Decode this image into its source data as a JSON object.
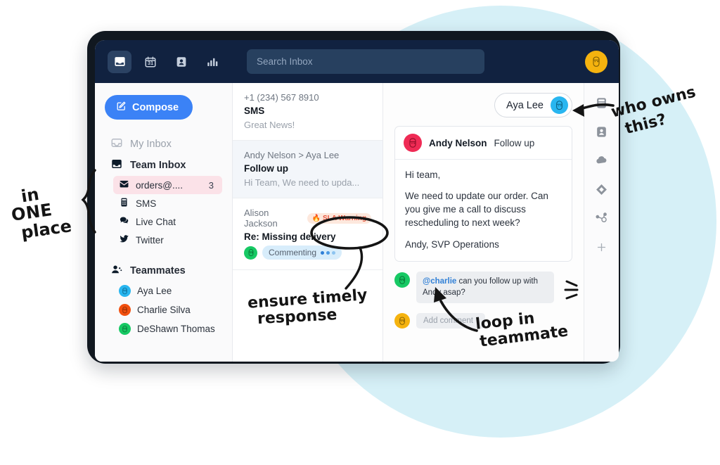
{
  "topnav": {
    "icons": [
      {
        "name": "inbox-icon",
        "label": "Inbox",
        "active": true
      },
      {
        "name": "calendar-icon",
        "label": "Calendar",
        "day": "31",
        "active": false
      },
      {
        "name": "contact-icon",
        "label": "Contacts",
        "active": false
      },
      {
        "name": "analytics-icon",
        "label": "Reports",
        "active": false
      }
    ],
    "search": {
      "placeholder": "Search Inbox",
      "value": ""
    },
    "avatar": {
      "name": "user-avatar",
      "color": "#f5b30f"
    }
  },
  "sidebar": {
    "compose_label": "Compose",
    "compose_icon": "compose-pencil-icon",
    "nav": [
      {
        "label": "My Inbox",
        "icon": "inbox-outline-icon",
        "muted": true
      },
      {
        "label": "Team Inbox",
        "icon": "inbox-filled-icon",
        "muted": false
      }
    ],
    "channels": [
      {
        "label": "orders@....",
        "icon": "envelope-icon",
        "count": "3",
        "selected": true
      },
      {
        "label": "SMS",
        "icon": "mobile-icon",
        "count": "",
        "selected": false
      },
      {
        "label": "Live Chat",
        "icon": "chat-bubble-icon",
        "count": "",
        "selected": false
      },
      {
        "label": "Twitter",
        "icon": "twitter-bird-icon",
        "count": "",
        "selected": false
      }
    ],
    "teammates_heading": "Teammates",
    "teammates_icon": "people-icon",
    "teammates": [
      {
        "name": "Aya Lee",
        "color": "#29b6f0"
      },
      {
        "name": "Charlie Silva",
        "color": "#f2500f"
      },
      {
        "name": "DeShawn Thomas",
        "color": "#17c964"
      }
    ]
  },
  "conversations": [
    {
      "from": "+1 (234) 567 8910",
      "subject": "SMS",
      "preview": "Great News!",
      "selected": false,
      "badge": "",
      "status": ""
    },
    {
      "from": "Andy Nelson > Aya Lee",
      "subject": "Follow up",
      "preview": "Hi Team, We need to upda...",
      "selected": true,
      "badge": "",
      "status": ""
    },
    {
      "from": "Alison Jackson",
      "subject": "Re: Missing delivery",
      "preview": "",
      "selected": false,
      "badge": "🔥 SLA Warning",
      "status": "Commenting",
      "status_avatar_color": "#17c964"
    }
  ],
  "detail": {
    "assignee": {
      "name": "Aya Lee",
      "avatar_color": "#29b6f0"
    },
    "message": {
      "sender": "Andy Nelson",
      "sender_avatar_color": "#ef2b55",
      "subject": "Follow up",
      "paragraphs": [
        "Hi team,",
        "We need to update our order. Can you give me a call to discuss rescheduling to next week?",
        "Andy, SVP Operations"
      ]
    },
    "comment": {
      "avatar_color": "#17c964",
      "mention": "@charlie",
      "text": " can you follow up with Andy asap?"
    },
    "add_comment": {
      "avatar_color": "#f5b30f",
      "placeholder": "Add comment"
    }
  },
  "rail": [
    {
      "name": "card-icon"
    },
    {
      "name": "contact-card-icon"
    },
    {
      "name": "cloud-icon"
    },
    {
      "name": "diamond-icon"
    },
    {
      "name": "hubspot-icon"
    },
    {
      "name": "plus-icon"
    }
  ],
  "annotations": {
    "one_place": {
      "l1": "in",
      "l2": "ONE",
      "l3": "place"
    },
    "timely": {
      "l1": "ensure timely",
      "l2": "response"
    },
    "owns": {
      "l1": "who owns",
      "l2": "this?"
    },
    "loop": {
      "l1": "loop in",
      "l2": "teammate"
    }
  }
}
